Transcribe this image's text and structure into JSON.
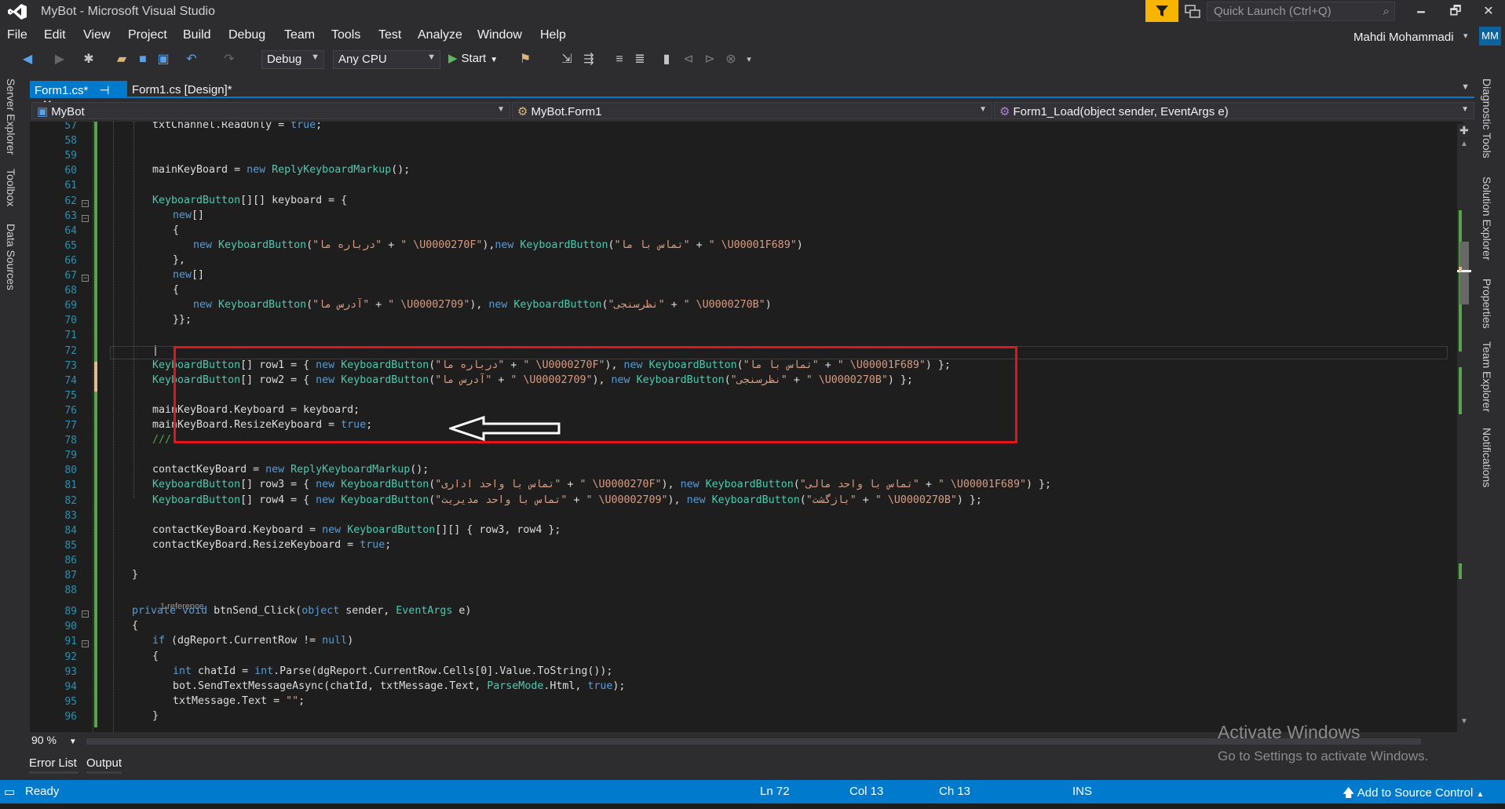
{
  "window": {
    "title": "MyBot - Microsoft Visual Studio",
    "quick_launch_placeholder": "Quick Launch (Ctrl+Q)",
    "user_name": "Mahdi Mohammadi",
    "user_initials": "MM",
    "minimize": "🗕",
    "restore": "🗗",
    "close": "✕"
  },
  "menu": [
    "File",
    "Edit",
    "View",
    "Project",
    "Build",
    "Debug",
    "Team",
    "Tools",
    "Test",
    "Analyze",
    "Window",
    "Help"
  ],
  "toolbar": {
    "config": "Debug",
    "platform": "Any CPU",
    "start_label": "Start"
  },
  "left_tabs": [
    "Server Explorer",
    "Toolbox",
    "Data Sources"
  ],
  "right_tabs": [
    "Diagnostic Tools",
    "Solution Explorer",
    "Properties",
    "Team Explorer",
    "Notifications"
  ],
  "doc_tabs": [
    {
      "label": "Form1.cs*",
      "pin": "⊣",
      "close": "✕"
    },
    {
      "label": "Form1.cs [Design]*"
    }
  ],
  "nav": {
    "project": "MyBot",
    "class": "MyBot.Form1",
    "member": "Form1_Load(object sender, EventArgs e)"
  },
  "line_numbers": [
    "57",
    "58",
    "59",
    "60",
    "61",
    "62",
    "63",
    "64",
    "65",
    "66",
    "67",
    "68",
    "69",
    "70",
    "71",
    "72",
    "73",
    "74",
    "75",
    "76",
    "77",
    "78",
    "79",
    "80",
    "81",
    "82",
    "83",
    "84",
    "85",
    "86",
    "87",
    "88",
    "89",
    "90",
    "91",
    "92",
    "93",
    "94",
    "95",
    "96"
  ],
  "code_lens": "1 reference",
  "zoom": "90 %",
  "watermark": {
    "line1": "Activate Windows",
    "line2": "Go to Settings to activate Windows."
  },
  "bottom_tabs": [
    "Error List",
    "Output"
  ],
  "status": {
    "ready": "Ready",
    "ln": "Ln 72",
    "col": "Col 13",
    "ch": "Ch 13",
    "ins": "INS",
    "source_control": "Add to Source Control"
  },
  "colors": {
    "accent": "#007acc",
    "highlight_box": "#e5141c",
    "filter": "#f7b500"
  }
}
